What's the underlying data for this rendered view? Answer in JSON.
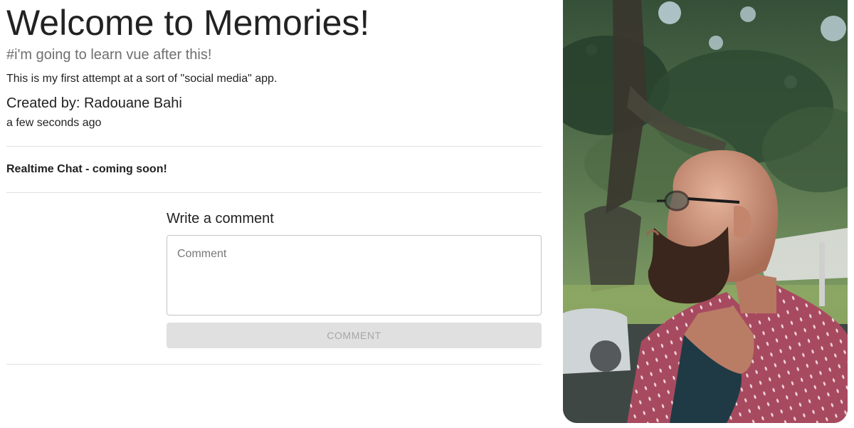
{
  "post": {
    "title": "Welcome to Memories!",
    "tags": "#i'm going to learn vue after this!",
    "message": "This is my first attempt at a sort of \"social media\" app.",
    "author": "Created by: Radouane Bahi",
    "time": "a few seconds ago",
    "chat_note": "Realtime Chat - coming soon!"
  },
  "comments": {
    "heading": "Write a comment",
    "placeholder": "Comment",
    "button_label": "Comment"
  },
  "image": {
    "alt": "photo of a bald bearded man with glasses in profile",
    "colors": {
      "sky": "#c9dde8",
      "foliage_dark": "#27402c",
      "foliage_mid": "#4f6b45",
      "grass": "#8ea863",
      "shirt": "#a84a5f",
      "skin": "#c99076",
      "beard": "#3a261c",
      "tank": "#1f3a45"
    }
  }
}
